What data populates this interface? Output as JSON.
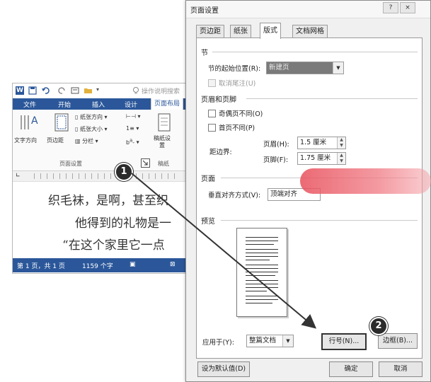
{
  "word": {
    "logo": "W",
    "tell_me": "操作说明搜索",
    "tabs": [
      "文件",
      "开始",
      "插入",
      "设计",
      "页面布局"
    ],
    "ribbon": {
      "text_direction": "文字方向",
      "margins": "页边距",
      "orientation": "纸张方向",
      "size": "纸张大小",
      "columns": "分栏",
      "manuscript": "稿纸设置",
      "group_page_setup": "页面设置",
      "group_manuscript": "稿纸"
    },
    "doc_lines": [
      "织毛袜，是啊，甚至织",
      "他得到的礼物是一",
      "“在这个家里它一点"
    ],
    "status": {
      "page": "第 1 页，共 1 页",
      "words": "1159 个字"
    },
    "colors": {
      "accent": "#2b579a"
    }
  },
  "dialog": {
    "title": "页面设置",
    "title_buttons": {
      "help": "?",
      "close": "×"
    },
    "tabs": [
      "页边距",
      "纸张",
      "版式",
      "文档网格"
    ],
    "active_tab": "版式",
    "section": {
      "heading": "节",
      "start_label": "节的起始位置(R):",
      "start_value": "新建页",
      "suppress_endnotes": "取消尾注(U)"
    },
    "header_footer": {
      "heading": "页眉和页脚",
      "odd_even": "奇偶页不同(O)",
      "first_page": "首页不同(P)",
      "from_edge": "距边界:",
      "header_label": "页眉(H):",
      "header_value": "1.5 厘米",
      "footer_label": "页脚(F):",
      "footer_value": "1.75 厘米"
    },
    "page": {
      "heading": "页面",
      "valign_label": "垂直对齐方式(V):",
      "valign_value": "顶端对齐"
    },
    "preview": {
      "heading": "预览"
    },
    "apply_label": "应用于(Y):",
    "apply_value": "整篇文档",
    "line_numbers_button": "行号(N)...",
    "borders_button": "边框(B)...",
    "set_default_button": "设为默认值(D)",
    "ok_button": "确定",
    "cancel_button": "取消"
  },
  "callouts": {
    "step1": "1",
    "step2": "2"
  }
}
